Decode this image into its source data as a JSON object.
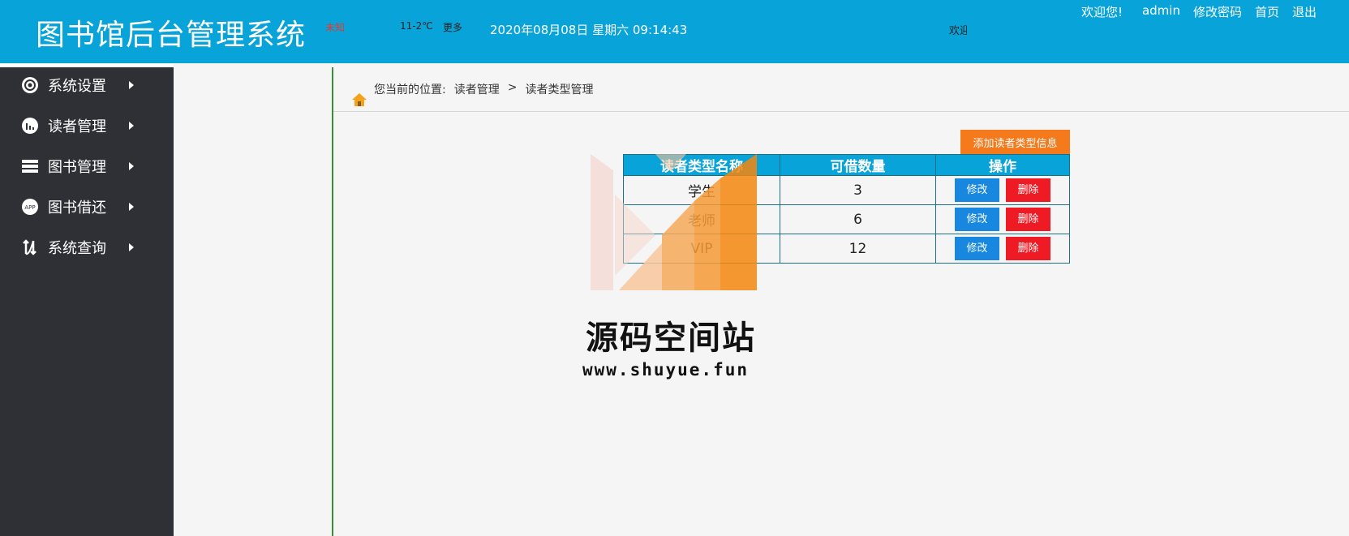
{
  "header": {
    "title": "图书馆后台管理系统",
    "weather_city": "未知",
    "weather_temp": "11-2℃",
    "weather_more": "更多",
    "datetime": "2020年08月08日 星期六 09:14:43",
    "marquee": "欢迎",
    "welcome": "欢迎您!",
    "username": "admin",
    "change_password": "修改密码",
    "home": "首页",
    "logout": "退出"
  },
  "sidebar": {
    "items": [
      {
        "label": "系统设置",
        "icon": "gear-icon"
      },
      {
        "label": "读者管理",
        "icon": "chart-icon"
      },
      {
        "label": "图书管理",
        "icon": "books-icon"
      },
      {
        "label": "图书借还",
        "icon": "app-icon"
      },
      {
        "label": "系统查询",
        "icon": "swap-icon"
      }
    ]
  },
  "breadcrumb": {
    "prefix": "您当前的位置:",
    "level1": "读者管理",
    "separator": ">",
    "level2": "读者类型管理"
  },
  "actions": {
    "add_label": "添加读者类型信息"
  },
  "table": {
    "headers": [
      "读者类型名称",
      "可借数量",
      "操作"
    ],
    "rows": [
      {
        "name": "学生",
        "quantity": "3"
      },
      {
        "name": "老师",
        "quantity": "6"
      },
      {
        "name": "VIP",
        "quantity": "12"
      }
    ],
    "edit_label": "修改",
    "delete_label": "删除"
  },
  "watermark": {
    "title": "源码空间站",
    "url": "www.shuyue.fun"
  },
  "colors": {
    "header_bg": "#08a3d8",
    "sidebar_bg": "#2f2f36",
    "add_button": "#f47a1c",
    "edit_button": "#1787e0",
    "delete_button": "#ee1a24"
  }
}
